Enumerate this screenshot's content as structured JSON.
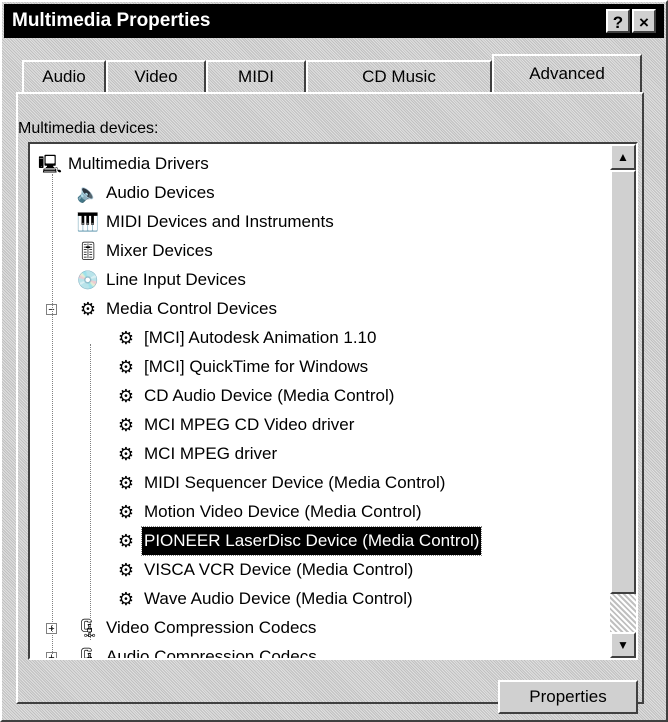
{
  "window": {
    "title": "Multimedia Properties",
    "help_label": "?",
    "close_label": "×"
  },
  "tabs": [
    {
      "label": "Audio",
      "active": false
    },
    {
      "label": "Video",
      "active": false
    },
    {
      "label": "MIDI",
      "active": false
    },
    {
      "label": "CD Music",
      "active": false
    },
    {
      "label": "Advanced",
      "active": true
    }
  ],
  "group": {
    "label": "Multimedia devices:"
  },
  "tree": {
    "root": {
      "label": "Multimedia Drivers",
      "icon": "computer-icon"
    },
    "categories": [
      {
        "label": "Audio Devices",
        "icon": "speaker-icon"
      },
      {
        "label": "MIDI Devices and Instruments",
        "icon": "midi-icon"
      },
      {
        "label": "Mixer Devices",
        "icon": "mixer-icon"
      },
      {
        "label": "Line Input Devices",
        "icon": "cd-icon"
      },
      {
        "label": "Media Control Devices",
        "icon": "media-control-icon",
        "expanded": true,
        "children": [
          {
            "label": "[MCI] Autodesk Animation 1.10"
          },
          {
            "label": "[MCI] QuickTime for Windows"
          },
          {
            "label": "CD Audio Device (Media Control)"
          },
          {
            "label": "MCI MPEG CD Video driver"
          },
          {
            "label": "MCI MPEG driver"
          },
          {
            "label": "MIDI Sequencer Device (Media Control)"
          },
          {
            "label": "Motion Video Device (Media Control)"
          },
          {
            "label": "PIONEER LaserDisc Device (Media Control)",
            "selected": true
          },
          {
            "label": "VISCA VCR Device (Media Control)"
          },
          {
            "label": "Wave Audio Device (Media Control)"
          }
        ]
      },
      {
        "label": "Video Compression Codecs",
        "icon": "codec-icon"
      },
      {
        "label": "Audio Compression Codecs",
        "icon": "codec-icon"
      }
    ]
  },
  "buttons": {
    "properties_label": "Properties"
  },
  "colors": {
    "titlebar": "#000000",
    "selection": "#000000",
    "face": "#d0d0d0"
  }
}
